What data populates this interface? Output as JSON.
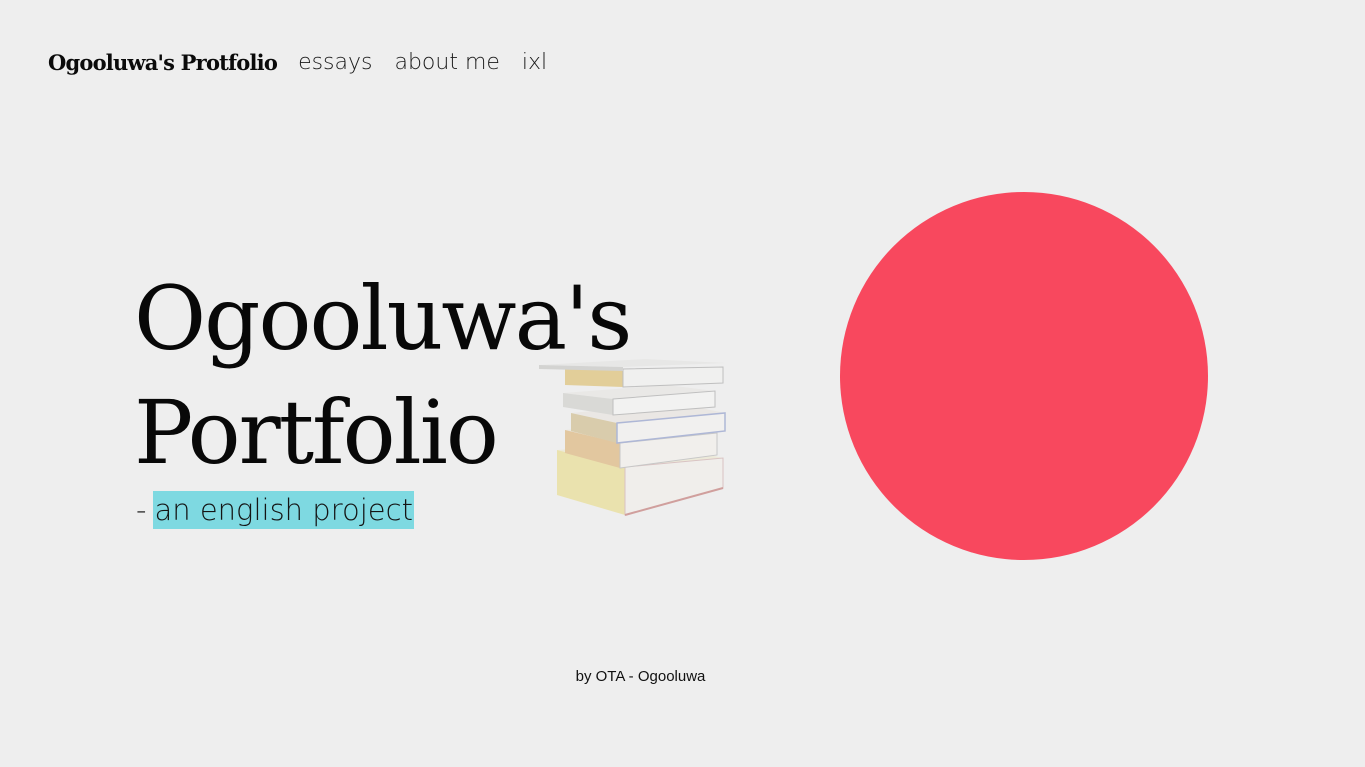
{
  "nav": {
    "brand": "Ogooluwa's Protfolio",
    "links": [
      {
        "label": "essays"
      },
      {
        "label": "about me"
      },
      {
        "label": "ixl"
      }
    ]
  },
  "hero": {
    "title_line1": "Ogooluwa's",
    "title_line2": "Portfolio",
    "subtitle_prefix": "-",
    "subtitle_highlight": "an english project"
  },
  "decor": {
    "books_icon": "stacked-books-image",
    "circle_color": "#f8485e",
    "highlight_color": "#7ed9e1"
  },
  "footer": {
    "credit": "by OTA - Ogooluwa"
  }
}
